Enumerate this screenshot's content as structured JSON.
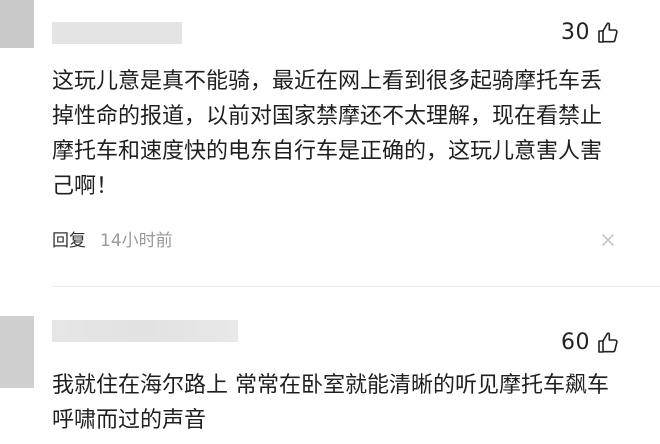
{
  "comments": [
    {
      "likes": "30",
      "text": "这玩儿意是真不能骑，最近在网上看到很多起骑摩托车丢掉性命的报道，以前对国家禁摩还不太理解，现在看禁止摩托车和速度快的电东自行车是正确的，这玩儿意害人害己啊！",
      "reply_label": "回复",
      "time": "14小时前",
      "more_icon": "close-icon"
    },
    {
      "likes": "60",
      "text": "我就住在海尔路上 常常在卧室就能清晰的听见摩托车飙车呼啸而过的声音"
    }
  ],
  "icons": {
    "like": "thumbs-up-icon"
  }
}
